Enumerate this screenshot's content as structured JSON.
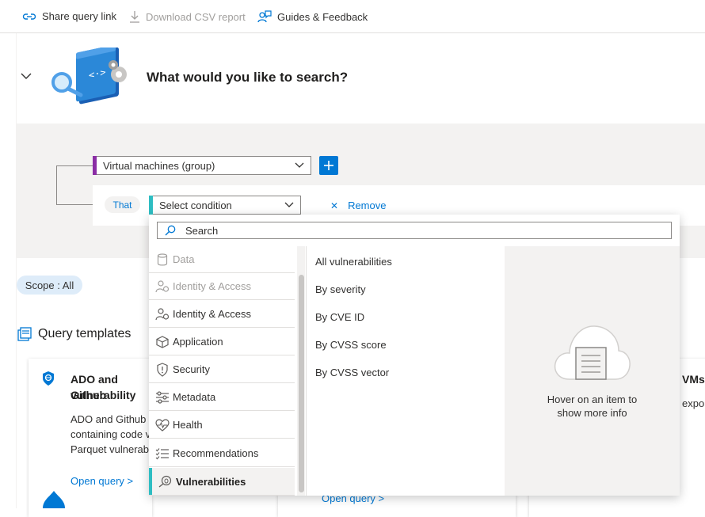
{
  "toolbar": {
    "share_label": "Share query link",
    "download_label": "Download CSV report",
    "guides_label": "Guides & Feedback"
  },
  "header": {
    "title": "What would you like to search?"
  },
  "query": {
    "resource_dropdown": "Virtual machines (group)",
    "that_label": "That",
    "condition_dropdown": "Select condition",
    "remove_label": "Remove"
  },
  "scope": {
    "label": "Scope : All"
  },
  "templates": {
    "title": "Query templates",
    "cards": [
      {
        "title_line1": "ADO and Github",
        "title_line2": "vulnerability",
        "desc_line1": "ADO and Github",
        "desc_line2": "containing code v",
        "desc_line3": "Parquet vulnerab",
        "link": "Open query >"
      },
      {
        "link": "Open query >"
      },
      {
        "title_fragment": "VMs",
        "desc_fragment": "expo"
      }
    ]
  },
  "dropdown_menu": {
    "search_placeholder": "Search",
    "categories": [
      {
        "label": "Data",
        "icon": "cylinder-icon",
        "state": "disabled"
      },
      {
        "label": "Identity & Access",
        "icon": "identity-icon",
        "state": "disabled"
      },
      {
        "label": "Identity & Access",
        "icon": "identity-icon",
        "state": "normal"
      },
      {
        "label": "Application",
        "icon": "cube-icon",
        "state": "normal"
      },
      {
        "label": "Security",
        "icon": "shield-icon",
        "state": "normal"
      },
      {
        "label": "Metadata",
        "icon": "sliders-icon",
        "state": "normal"
      },
      {
        "label": "Health",
        "icon": "heart-icon",
        "state": "normal"
      },
      {
        "label": "Recommendations",
        "icon": "checklist-icon",
        "state": "normal"
      },
      {
        "label": "Vulnerabilities",
        "icon": "bug-search-icon",
        "state": "selected"
      }
    ],
    "options": [
      "All vulnerabilities",
      "By severity",
      "By CVE ID",
      "By CVSS score",
      "By CVSS vector"
    ],
    "info_line1": "Hover on an item to",
    "info_line2": "show more info"
  },
  "colors": {
    "accent": "#0078d4",
    "resource_bar": "#8a2da5",
    "condition_bar": "#2ebdc2",
    "panel_bg": "#f3f2f1"
  }
}
